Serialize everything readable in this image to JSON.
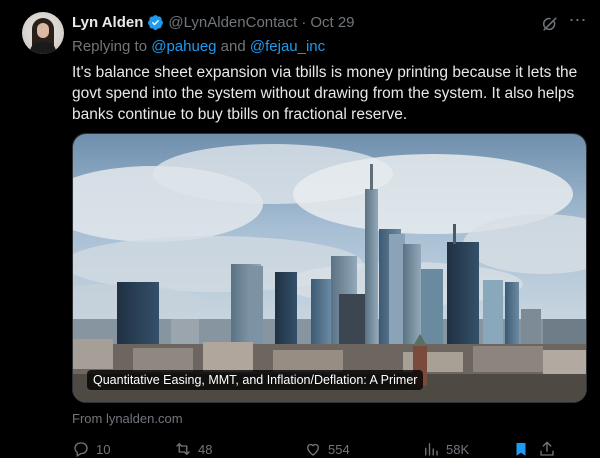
{
  "tweet": {
    "author_name": "Lyn Alden",
    "handle": "@LynAldenContact",
    "separator": "·",
    "date": "Oct 29",
    "reply_prefix": "Replying to",
    "mention_1": "@pahueg",
    "reply_and": "and",
    "mention_2": "@fejau_inc",
    "text": "It's balance sheet expansion via tbills is money printing because it lets the govt spend into the system without drawing from the system. It also helps banks continue to buy tbills on fractional reserve.",
    "card_title": "Quantitative Easing, MMT, and Inflation/Deflation: A Primer",
    "card_source": "From lynalden.com",
    "more_icon": "⋯"
  },
  "actions": {
    "replies": "10",
    "reposts": "48",
    "likes": "554",
    "views": "58K"
  },
  "colors": {
    "background": "#000000",
    "text": "#e7e9ea",
    "muted": "#71767b",
    "accent": "#1d9bf0"
  },
  "icons": [
    "verified-badge-icon",
    "grok-icon",
    "more-icon",
    "reply-icon",
    "repost-icon",
    "like-icon",
    "views-icon",
    "bookmark-icon",
    "share-icon"
  ]
}
